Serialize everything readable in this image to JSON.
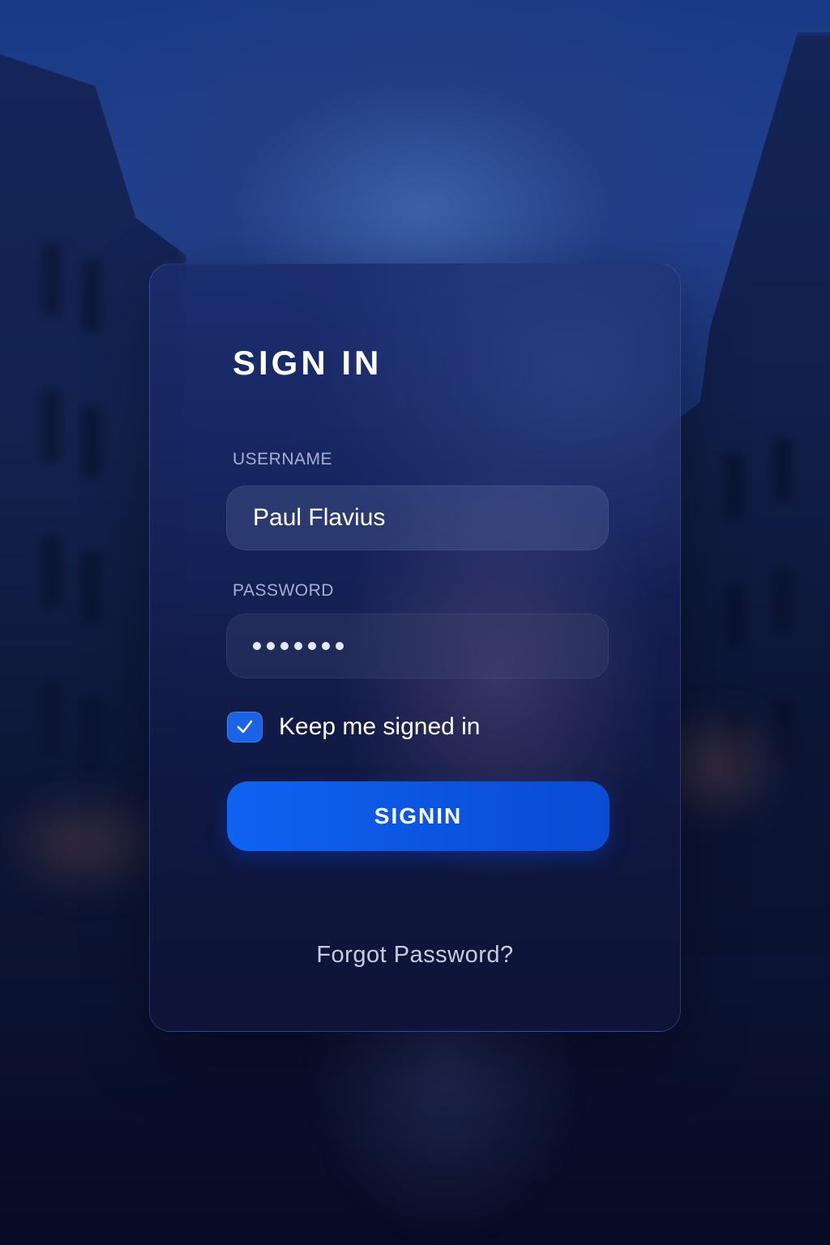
{
  "card": {
    "title": "SIGN IN",
    "username": {
      "label": "USERNAME",
      "value": "Paul Flavius"
    },
    "password": {
      "label": "PASSWORD",
      "masked_length": 7
    },
    "keep_signed_in": {
      "label": "Keep me signed in",
      "checked": true
    },
    "submit_label": "SIGNIN",
    "forgot_label": "Forgot Password?"
  },
  "colors": {
    "accent": "#1b63e6",
    "button": "#0f5ceb",
    "card_background": "#1a2a6e"
  },
  "icons": {
    "checkbox": "checkmark-icon"
  }
}
